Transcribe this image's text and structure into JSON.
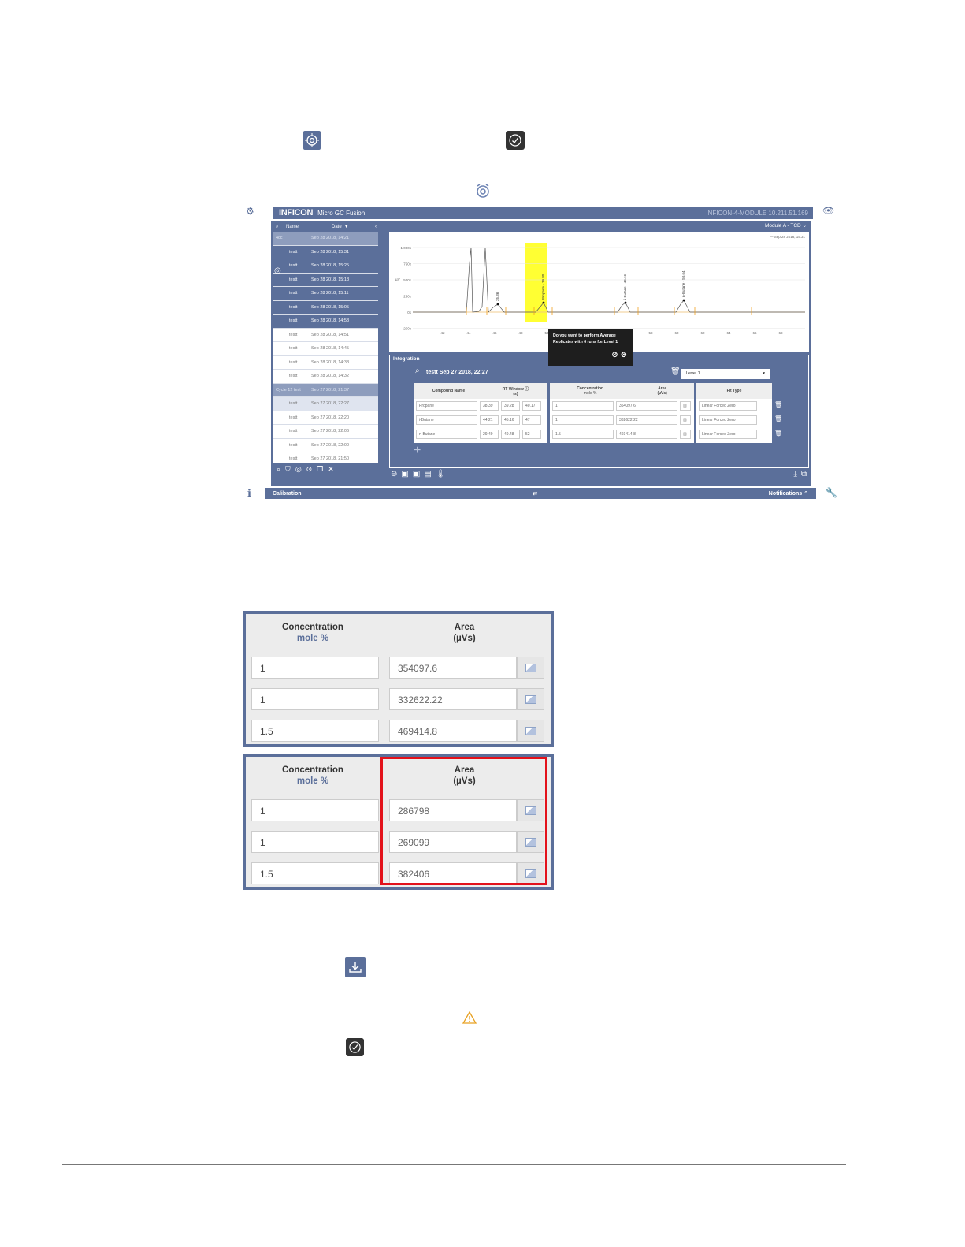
{
  "screenshot": {
    "brand": "INFICON",
    "product": "Micro GC Fusion",
    "host": "INFICON-4-MODULE 10.211.51.169",
    "list_header": {
      "name": "Name",
      "date": "Date"
    },
    "runs": [
      {
        "kind": "group",
        "name": "4cc",
        "date": "Sep 28 2018, 14:21"
      },
      {
        "kind": "sel",
        "name": "testt",
        "date": "Sep 28 2018, 15:31"
      },
      {
        "kind": "sel",
        "name": "testt",
        "date": "Sep 28 2018, 15:25"
      },
      {
        "kind": "sel",
        "name": "testt",
        "date": "Sep 28 2018, 15:18"
      },
      {
        "kind": "sel",
        "name": "testt",
        "date": "Sep 28 2018, 15:11"
      },
      {
        "kind": "sel",
        "name": "testt",
        "date": "Sep 28 2018, 15:05"
      },
      {
        "kind": "sel",
        "name": "testt",
        "date": "Sep 28 2018, 14:58"
      },
      {
        "kind": "plain",
        "name": "testt",
        "date": "Sep 28 2018, 14:51"
      },
      {
        "kind": "plain",
        "name": "testt",
        "date": "Sep 28 2018, 14:45"
      },
      {
        "kind": "plain",
        "name": "testt",
        "date": "Sep 28 2018, 14:38"
      },
      {
        "kind": "plain",
        "name": "testt",
        "date": "Sep 28 2018, 14:32"
      },
      {
        "kind": "group",
        "name": "Cycle 12 test",
        "date": "Sep 27 2018, 21:37"
      },
      {
        "kind": "shaded",
        "name": "testt",
        "date": "Sep 27 2018, 22:27"
      },
      {
        "kind": "plain",
        "name": "testt",
        "date": "Sep 27 2018, 22:20"
      },
      {
        "kind": "plain",
        "name": "testt",
        "date": "Sep 27 2018, 22:06"
      },
      {
        "kind": "plain",
        "name": "testt",
        "date": "Sep 27 2018, 22:00"
      },
      {
        "kind": "plain",
        "name": "testt",
        "date": "Sep 27 2018, 21:50"
      }
    ],
    "module": "Module A - TCD",
    "chart_legend": "Sep 28 2018, 15:31",
    "y_ticks": [
      "1,000k",
      "750k",
      "500k",
      "250k",
      "0k",
      "-250k"
    ],
    "y_unit": "µV",
    "x_ticks": [
      "42",
      "44",
      "46",
      "48",
      "50",
      "52",
      "54",
      "56",
      "58",
      "60",
      "62",
      "64",
      "66",
      "68"
    ],
    "peak_labels": [
      "35.36",
      "Propane - 39.80",
      "i-Butane - 46.16",
      "n-Butane - 50.64"
    ],
    "integration_title": "Integration",
    "run_title": "testt Sep 27 2018, 22:27",
    "level": "Level 1",
    "table_headers": {
      "compound": "Compound Name",
      "rt": "RT Window",
      "rt_unit": "(s)",
      "conc": "Concentration",
      "conc_unit": "mole %",
      "area": "Area",
      "area_unit": "(µVs)",
      "fit": "Fit Type"
    },
    "rows": [
      {
        "compound": "Propane",
        "rt1": "38.39",
        "rt2": "39.28",
        "rt3": "40.17",
        "conc": "1",
        "area": "354097.6",
        "fit": "Linear Forced Zero"
      },
      {
        "compound": "i-Butane",
        "rt1": "44.21",
        "rt2": "45.16",
        "rt3": "47",
        "conc": "1",
        "area": "332622.22",
        "fit": "Linear Forced Zero"
      },
      {
        "compound": "n-Butane",
        "rt1": "29.49",
        "rt2": "49.48",
        "rt3": "52",
        "conc": "1.5",
        "area": "469414.8",
        "fit": "Linear Forced Zero"
      }
    ],
    "popup_text": "Do you want to perform Average Replicates with 6 runs for Level 1",
    "footer_left": "Calibration",
    "footer_right": "Notifications"
  },
  "zoom_before": {
    "conc_header": "Concentration",
    "conc_unit": "mole %",
    "area_header": "Area",
    "area_unit": "(µVs)",
    "rows": [
      {
        "conc": "1",
        "area": "354097.6"
      },
      {
        "conc": "1",
        "area": "332622.22"
      },
      {
        "conc": "1.5",
        "area": "469414.8"
      }
    ]
  },
  "zoom_after": {
    "conc_header": "Concentration",
    "conc_unit": "mole %",
    "area_header": "Area",
    "area_unit": "(µVs)",
    "rows": [
      {
        "conc": "1",
        "area": "286798"
      },
      {
        "conc": "1",
        "area": "269099"
      },
      {
        "conc": "1.5",
        "area": "382406"
      }
    ]
  },
  "colors": {
    "brand": "#5b6f9a",
    "highlight": "#ffff33",
    "trace": "#555555",
    "marker": "#f0a020",
    "redbox": "#e3121b"
  }
}
